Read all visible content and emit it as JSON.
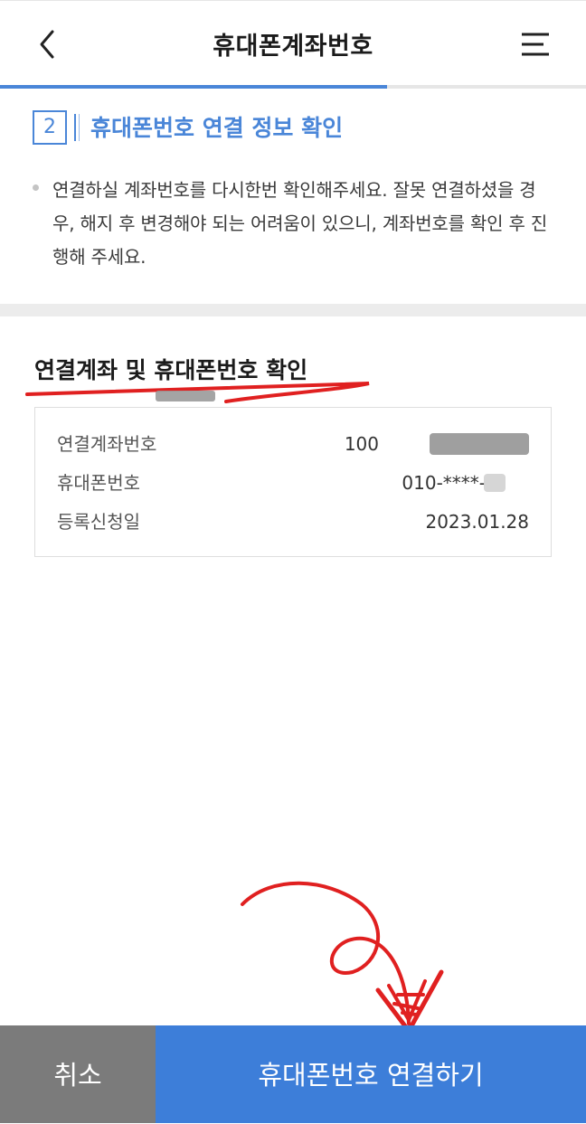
{
  "header": {
    "title": "휴대폰계좌번호",
    "back_icon": "chevron-left-icon",
    "menu_icon": "hamburger-menu-icon"
  },
  "progress": {
    "fraction": 0.66,
    "color": "#4a86d8"
  },
  "step": {
    "number": "2",
    "title": "휴대폰번호 연결 정보 확인"
  },
  "notice": {
    "text": "연결하실 계좌번호를 다시한번 확인해주세요. 잘못 연결하셨을 경우, 해지 후 변경해야 되는 어려움이 있으니, 계좌번호를 확인 후 진행해 주세요."
  },
  "section": {
    "title": "연결계좌 및 휴대폰번호 확인"
  },
  "info": {
    "rows": [
      {
        "label": "연결계좌번호",
        "value": "100"
      },
      {
        "label": "휴대폰번호",
        "value": "010-****-"
      },
      {
        "label": "등록신청일",
        "value": "2023.01.28"
      }
    ]
  },
  "buttons": {
    "cancel": "취소",
    "connect": "휴대폰번호 연결하기"
  },
  "colors": {
    "accent": "#4a86d8",
    "primary_button": "#3d7ed9",
    "cancel_button": "#7b7b7b",
    "annotation": "#e02020"
  }
}
